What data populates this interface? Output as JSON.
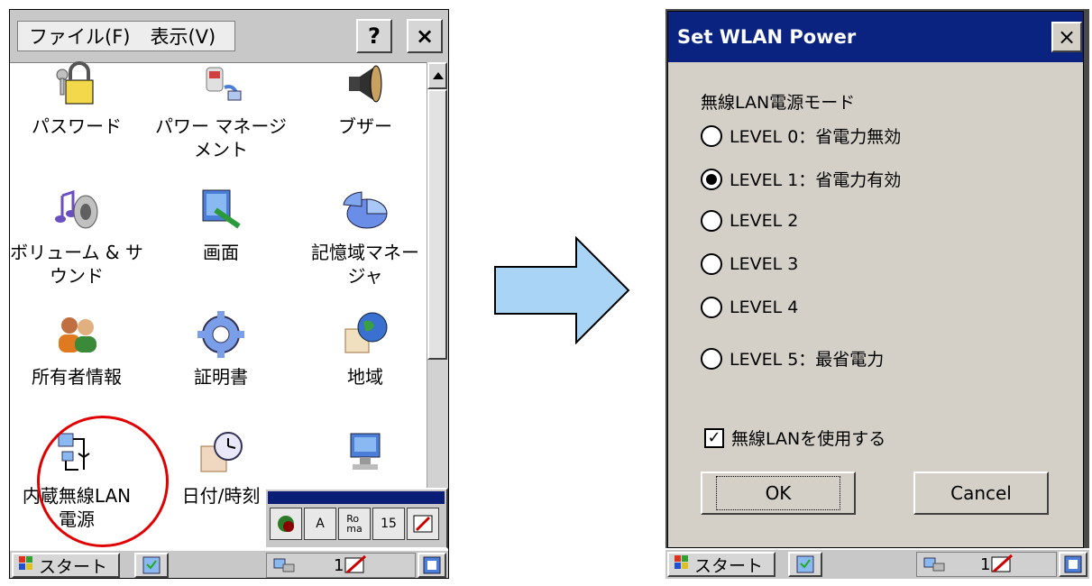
{
  "left": {
    "menu": {
      "file": "ファイル(F)",
      "view": "表示(V)"
    },
    "toolbar": {
      "help": "?",
      "close": "×"
    },
    "icons": [
      {
        "label": "パスワード",
        "icon": "padlock-keys-icon"
      },
      {
        "label": "パワー マネージ\nメント",
        "icon": "power-plug-icon"
      },
      {
        "label": "ブザー",
        "icon": "speaker-icon"
      },
      {
        "label": "ボリューム & サ\nウンド",
        "icon": "volume-sound-icon"
      },
      {
        "label": "画面",
        "icon": "display-icon"
      },
      {
        "label": "記憶域マネー\nジャ",
        "icon": "storage-pie-icon"
      },
      {
        "label": "所有者情報",
        "icon": "owner-people-icon"
      },
      {
        "label": "証明書",
        "icon": "certificate-gear-icon"
      },
      {
        "label": "地域",
        "icon": "regional-globe-icon"
      },
      {
        "label": "内蔵無線LAN\n電源",
        "icon": "wlan-power-icon"
      },
      {
        "label": "日付/時刻",
        "icon": "date-time-clock-icon"
      },
      {
        "label": "",
        "icon": "input-panel-icon"
      }
    ],
    "sip": {
      "buttons": [
        "",
        "A",
        "Ro\nma",
        "15",
        ""
      ]
    },
    "taskbar": {
      "start": "スタート",
      "tray_number": "1"
    }
  },
  "dialog": {
    "title": "Set WLAN Power",
    "close": "×",
    "group_label": "無線LAN電源モード",
    "options": [
      "LEVEL 0：省電力無効",
      "LEVEL 1：省電力有効",
      "LEVEL 2",
      "LEVEL 3",
      "LEVEL 4",
      "LEVEL 5：最省電力"
    ],
    "selected_index": 1,
    "checkbox_label": "無線LANを使用する",
    "checkbox_checked": true,
    "ok": "OK",
    "cancel": "Cancel"
  },
  "right_taskbar": {
    "start": "スタート",
    "tray_number": "1"
  },
  "colors": {
    "titlebar": "#0a2280",
    "highlight_circle": "#e00000",
    "arrow_fill": "#a9d4f5"
  }
}
